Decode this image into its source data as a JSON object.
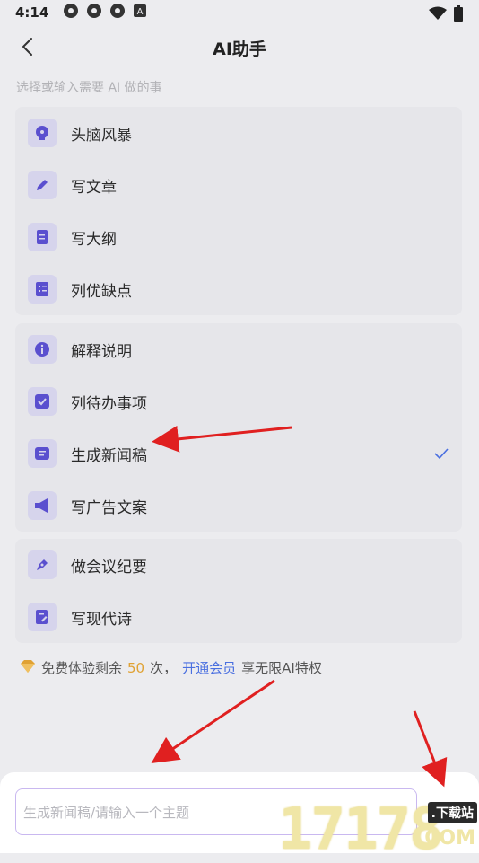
{
  "status_bar": {
    "time": "4:14",
    "icons": [
      "app-icon",
      "app-icon",
      "app-icon",
      "a-icon"
    ],
    "right_icons": [
      "wifi-icon",
      "battery-icon"
    ]
  },
  "header": {
    "title": "AI助手"
  },
  "hint": "选择或输入需要 AI 做的事",
  "groups": [
    {
      "items": [
        {
          "label": "头脑风暴",
          "icon": "brain-icon"
        },
        {
          "label": "写文章",
          "icon": "pencil-icon"
        },
        {
          "label": "写大纲",
          "icon": "document-icon"
        },
        {
          "label": "列优缺点",
          "icon": "list-icon"
        }
      ]
    },
    {
      "items": [
        {
          "label": "解释说明",
          "icon": "info-icon"
        },
        {
          "label": "列待办事项",
          "icon": "checkbox-icon"
        },
        {
          "label": "生成新闻稿",
          "icon": "news-icon",
          "selected": true
        },
        {
          "label": "写广告文案",
          "icon": "megaphone-icon"
        }
      ]
    },
    {
      "items": [
        {
          "label": "做会议纪要",
          "icon": "pen-icon"
        },
        {
          "label": "写现代诗",
          "icon": "edit-doc-icon"
        }
      ]
    }
  ],
  "promo": {
    "prefix": "免费体验剩余",
    "count": "50",
    "middle": "次，",
    "link": "开通会员",
    "suffix": "享无限AI特权"
  },
  "input": {
    "placeholder": "生成新闻稿/请输入一个主题"
  },
  "watermark": {
    "digits": "17178",
    "badge": ".下载站",
    "domain": ".COM"
  },
  "colors": {
    "accent": "#5a4fcf",
    "icon_bg": "#d6d4ec",
    "link": "#4a6fe0",
    "count": "#e0a234",
    "arrow": "#e02020"
  }
}
